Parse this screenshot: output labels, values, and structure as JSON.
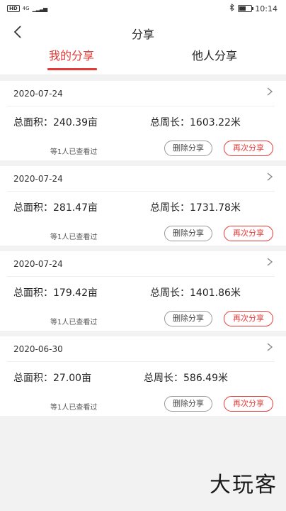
{
  "status_bar": {
    "hd_label": "HD",
    "network_label": "4G",
    "time": "10:14",
    "icons": [
      "signal-icon",
      "bluetooth-icon",
      "battery-icon"
    ]
  },
  "header": {
    "title": "分享",
    "back_icon": "chevron-left-icon"
  },
  "tabs": [
    {
      "label": "我的分享",
      "active": true
    },
    {
      "label": "他人分享",
      "active": false
    }
  ],
  "accent_color": "#e53935",
  "shares": [
    {
      "date": "2020-07-24",
      "area": "总面积：240.39亩",
      "perimeter": "总周长：1603.22米",
      "viewed": "等1人已查看过",
      "delete_label": "删除分享",
      "reshare_label": "再次分享"
    },
    {
      "date": "2020-07-24",
      "area": "总面积：281.47亩",
      "perimeter": "总周长：1731.78米",
      "viewed": "等1人已查看过",
      "delete_label": "删除分享",
      "reshare_label": "再次分享"
    },
    {
      "date": "2020-07-24",
      "area": "总面积：179.42亩",
      "perimeter": "总周长：1401.86米",
      "viewed": "等1人已查看过",
      "delete_label": "删除分享",
      "reshare_label": "再次分享"
    },
    {
      "date": "2020-06-30",
      "area": "总面积：27.00亩",
      "perimeter": "总周长：586.49米",
      "viewed": "等1人已查看过",
      "delete_label": "删除分享",
      "reshare_label": "再次分享"
    }
  ],
  "watermark": "大玩客"
}
